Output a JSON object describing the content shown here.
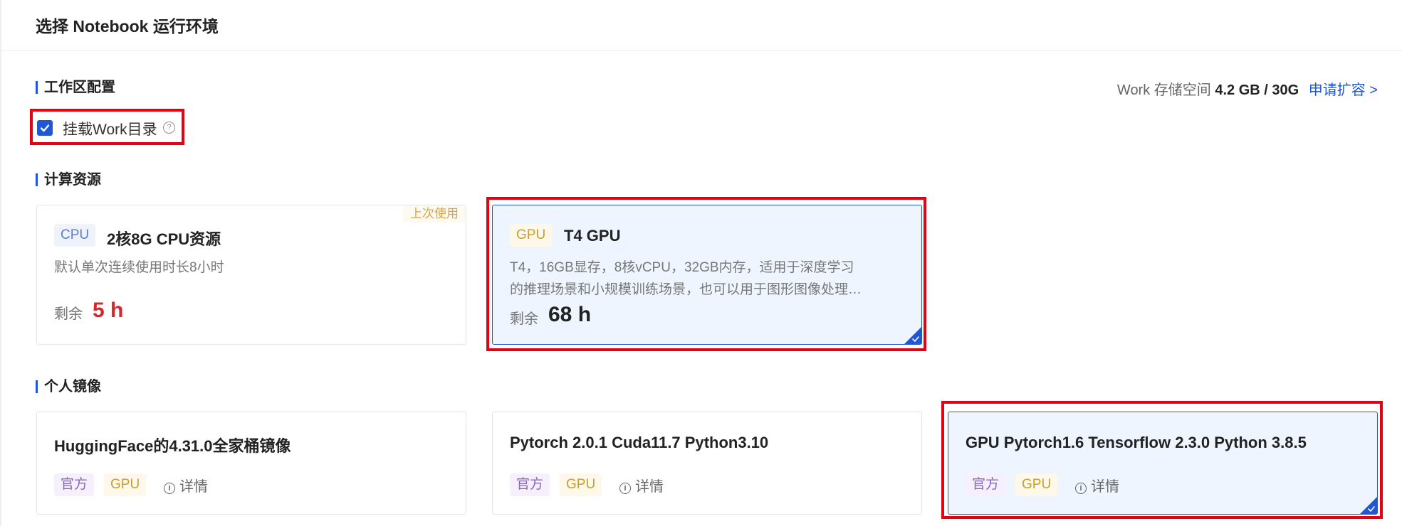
{
  "header": {
    "title": "选择 Notebook 运行环境"
  },
  "workspace": {
    "section_title": "工作区配置",
    "storage_label": "Work 存储空间",
    "storage_value": "4.2 GB / 30G",
    "expand_link": "申请扩容 >",
    "mount_label": "挂载Work目录",
    "mount_checked": true,
    "help_glyph": "?"
  },
  "compute": {
    "section_title": "计算资源",
    "cards": [
      {
        "tag": "CPU",
        "title": "2核8G CPU资源",
        "desc": "默认单次连续使用时长8小时",
        "remain_label": "剩余",
        "remain_value": "5 h",
        "badge": "上次使用",
        "selected": false
      },
      {
        "tag": "GPU",
        "title": "T4 GPU",
        "desc_line1": "T4，16GB显存，8核vCPU，32GB内存，适用于深度学习",
        "desc_line2": "的推理场景和小规模训练场景，也可以用于图形图像处理…",
        "remain_label": "剩余",
        "remain_value": "68 h",
        "selected": true
      }
    ]
  },
  "images": {
    "section_title": "个人镜像",
    "cards": [
      {
        "title": "HuggingFace的4.31.0全家桶镜像",
        "tag_official": "官方",
        "tag_gpu": "GPU",
        "detail": "详情",
        "selected": false
      },
      {
        "title": "Pytorch 2.0.1 Cuda11.7 Python3.10",
        "tag_official": "官方",
        "tag_gpu": "GPU",
        "detail": "详情",
        "selected": false
      },
      {
        "title": "GPU Pytorch1.6 Tensorflow 2.3.0 Python 3.8.5",
        "tag_official": "官方",
        "tag_gpu": "GPU",
        "detail": "详情",
        "selected": true
      }
    ]
  },
  "colors": {
    "accent": "#1f57d6",
    "highlight_box": "#e60012",
    "remain_red": "#d9262a"
  }
}
